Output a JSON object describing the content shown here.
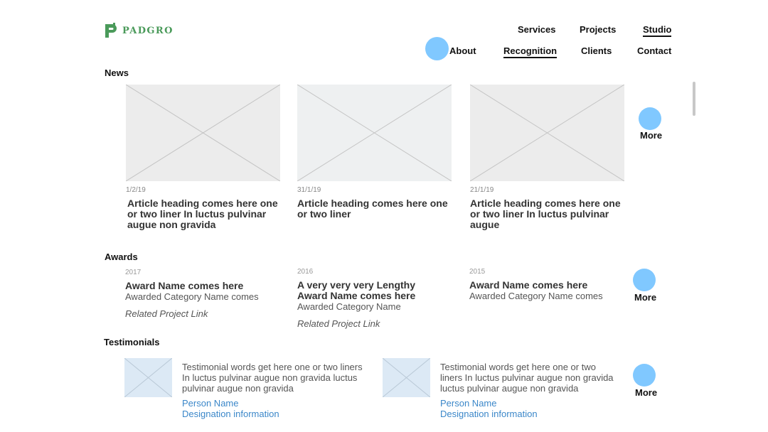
{
  "brand": {
    "logo_text": "PADGRO"
  },
  "nav": {
    "services": "Services",
    "projects": "Projects",
    "studio": "Studio",
    "about": "About",
    "recognition": "Recognition",
    "clients": "Clients",
    "contact": "Contact"
  },
  "news": {
    "title": "News",
    "more": "More",
    "items": [
      {
        "date": "1/2/19",
        "heading": "Article heading comes here one or two liner In luctus pulvinar augue non gravida"
      },
      {
        "date": "31/1/19",
        "heading": "Article heading comes here one or two liner"
      },
      {
        "date": "21/1/19",
        "heading": "Article heading comes here one or two liner In luctus pulvinar augue"
      }
    ]
  },
  "awards": {
    "title": "Awards",
    "more": "More",
    "items": [
      {
        "year": "2017",
        "name": "Award Name comes here",
        "category": "Awarded Category Name comes",
        "link": "Related Project Link"
      },
      {
        "year": "2016",
        "name": "A very very very Lengthy Award Name comes here",
        "category": "Awarded Category Name",
        "link": "Related Project Link"
      },
      {
        "year": "2015",
        "name": "Award Name comes here",
        "category": "Awarded Category Name comes",
        "link": ""
      }
    ]
  },
  "testimonials": {
    "title": "Testimonials",
    "more": "More",
    "items": [
      {
        "text": "Testimonial words get here one or two liners In luctus pulvinar augue non gravida luctus pulvinar augue non gravida",
        "person": "Person Name",
        "designation": "Designation information"
      },
      {
        "text": "Testimonial words get here one or two liners In luctus pulvinar augue non gravida luctus pulvinar augue non gravida",
        "person": "Person Name",
        "designation": "Designation information"
      }
    ]
  },
  "colors": {
    "hotspot": "#80c8ff",
    "logo": "#4a9a5a",
    "link": "#3b87c9",
    "placeholder": "#ececec",
    "testimonial_placeholder": "#dce9f5"
  },
  "icons": {
    "logo": "padgro-logo-icon",
    "image_placeholder": "image-placeholder-icon"
  }
}
